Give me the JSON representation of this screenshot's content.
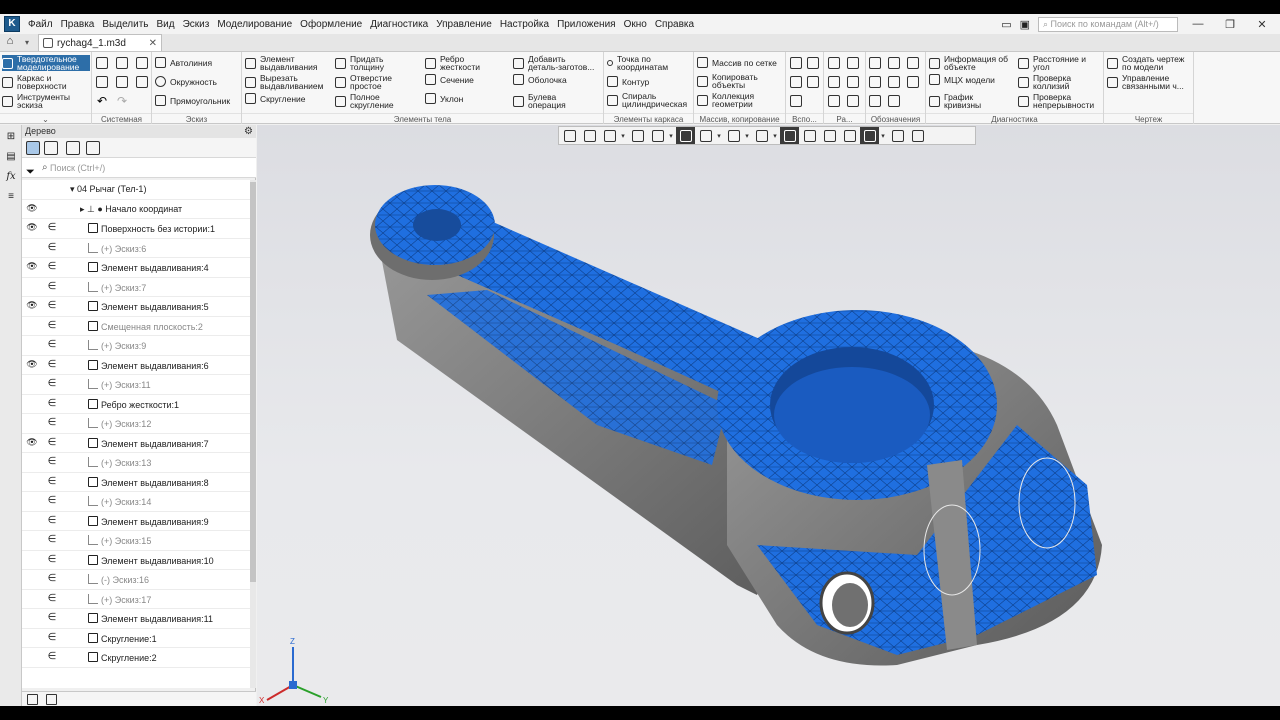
{
  "app": {
    "logo_text": "K"
  },
  "menu": [
    "Файл",
    "Правка",
    "Выделить",
    "Вид",
    "Эскиз",
    "Моделирование",
    "Оформление",
    "Диагностика",
    "Управление",
    "Настройка",
    "Приложения",
    "Окно",
    "Справка"
  ],
  "search": {
    "placeholder": "Поиск по командам (Alt+/)"
  },
  "window_controls": {
    "minimize": "—",
    "restore": "❐",
    "close": "✕"
  },
  "tab": {
    "name": "rychag4_1.m3d",
    "close": "✕"
  },
  "ribbon": {
    "left_modes": [
      "Твердотельное\nмоделирование",
      "Каркас и\nповерхности",
      "Инструменты\nэскиза"
    ],
    "groups": {
      "system": "Системная",
      "sketch": "Эскиз",
      "body": "Элементы тела",
      "frame": "Элементы каркаса",
      "array": "Массив, копирование",
      "aux": "Вспо...",
      "ra": "Ра...",
      "notation": "Обозначения",
      "diag": "Диагностика",
      "drawing": "Чертеж"
    },
    "sketch_items": [
      "Автолиния",
      "Окружность",
      "Прямоугольник"
    ],
    "body_col1": [
      "Элемент\nвыдавливания",
      "Вырезать\nвыдавливанием",
      "Скругление"
    ],
    "body_col2": [
      "Придать\nтолщину",
      "Отверстие\nпростое",
      "Полное\nскругление"
    ],
    "body_col3": [
      "Ребро\nжесткости",
      "Сечение",
      "Уклон"
    ],
    "body_col4": [
      "Добавить\nдеталь-заготов...",
      "Оболочка",
      "Булева\nоперация"
    ],
    "frame_items": [
      "Точка по\nкоординатам",
      "Контур",
      "Спираль\nцилиндрическая"
    ],
    "array_items": [
      "Массив по сетке",
      "Копировать\nобъекты",
      "Коллекция\nгеометрии"
    ],
    "diag_col1": [
      "Информация об\nобъекте",
      "МЦХ модели",
      "График\nкривизны"
    ],
    "diag_col2": [
      "Расстояние и\nугол",
      "Проверка\nколлизий",
      "Проверка\nнепрерывности"
    ],
    "drawing_items": [
      "Создать чертеж\nпо модели",
      "Управление\nсвязанными ч..."
    ]
  },
  "panel": {
    "title": "Дерево",
    "search_placeholder": "Поиск (Ctrl+/)",
    "tree": [
      {
        "label": "04 Рычаг (Тел-1)",
        "eye": false,
        "inc": false,
        "indent": 48,
        "dim": false,
        "kind": "root"
      },
      {
        "label": "Начало координат",
        "eye": true,
        "inc": false,
        "indent": 58,
        "dim": false,
        "kind": "origin"
      },
      {
        "label": "Поверхность без истории:1",
        "eye": true,
        "inc": true,
        "indent": 66,
        "dim": false,
        "kind": "feat"
      },
      {
        "label": "(+) Эскиз:6",
        "eye": false,
        "inc": true,
        "indent": 66,
        "dim": true,
        "kind": "sketch"
      },
      {
        "label": "Элемент выдавливания:4",
        "eye": true,
        "inc": true,
        "indent": 66,
        "dim": false,
        "kind": "feat"
      },
      {
        "label": "(+) Эскиз:7",
        "eye": false,
        "inc": true,
        "indent": 66,
        "dim": true,
        "kind": "sketch"
      },
      {
        "label": "Элемент выдавливания:5",
        "eye": true,
        "inc": true,
        "indent": 66,
        "dim": false,
        "kind": "feat"
      },
      {
        "label": "Смещенная плоскость:2",
        "eye": false,
        "inc": true,
        "indent": 66,
        "dim": true,
        "kind": "feat"
      },
      {
        "label": "(+) Эскиз:9",
        "eye": false,
        "inc": true,
        "indent": 66,
        "dim": true,
        "kind": "sketch"
      },
      {
        "label": "Элемент выдавливания:6",
        "eye": true,
        "inc": true,
        "indent": 66,
        "dim": false,
        "kind": "feat"
      },
      {
        "label": "(+) Эскиз:11",
        "eye": false,
        "inc": true,
        "indent": 66,
        "dim": true,
        "kind": "sketch"
      },
      {
        "label": "Ребро жесткости:1",
        "eye": false,
        "inc": true,
        "indent": 66,
        "dim": false,
        "kind": "feat"
      },
      {
        "label": "(+) Эскиз:12",
        "eye": false,
        "inc": true,
        "indent": 66,
        "dim": true,
        "kind": "sketch"
      },
      {
        "label": "Элемент выдавливания:7",
        "eye": true,
        "inc": true,
        "indent": 66,
        "dim": false,
        "kind": "feat"
      },
      {
        "label": "(+) Эскиз:13",
        "eye": false,
        "inc": true,
        "indent": 66,
        "dim": true,
        "kind": "sketch"
      },
      {
        "label": "Элемент выдавливания:8",
        "eye": false,
        "inc": true,
        "indent": 66,
        "dim": false,
        "kind": "feat"
      },
      {
        "label": "(+) Эскиз:14",
        "eye": false,
        "inc": true,
        "indent": 66,
        "dim": true,
        "kind": "sketch"
      },
      {
        "label": "Элемент выдавливания:9",
        "eye": false,
        "inc": true,
        "indent": 66,
        "dim": false,
        "kind": "feat"
      },
      {
        "label": "(+) Эскиз:15",
        "eye": false,
        "inc": true,
        "indent": 66,
        "dim": true,
        "kind": "sketch"
      },
      {
        "label": "Элемент выдавливания:10",
        "eye": false,
        "inc": true,
        "indent": 66,
        "dim": false,
        "kind": "feat"
      },
      {
        "label": "(-) Эскиз:16",
        "eye": false,
        "inc": true,
        "indent": 66,
        "dim": true,
        "kind": "sketch"
      },
      {
        "label": "(+) Эскиз:17",
        "eye": false,
        "inc": true,
        "indent": 66,
        "dim": true,
        "kind": "sketch"
      },
      {
        "label": "Элемент выдавливания:11",
        "eye": false,
        "inc": true,
        "indent": 66,
        "dim": false,
        "kind": "feat"
      },
      {
        "label": "Скругление:1",
        "eye": false,
        "inc": true,
        "indent": 66,
        "dim": false,
        "kind": "fillet"
      },
      {
        "label": "Скругление:2",
        "eye": false,
        "inc": true,
        "indent": 66,
        "dim": false,
        "kind": "fillet"
      }
    ]
  },
  "triad": {
    "x": "X",
    "y": "Y",
    "z": "Z"
  },
  "colors": {
    "mesh_blue": "#1f6fe0",
    "model_gray": "#7c7c7c",
    "accent": "#2d6ea8"
  }
}
